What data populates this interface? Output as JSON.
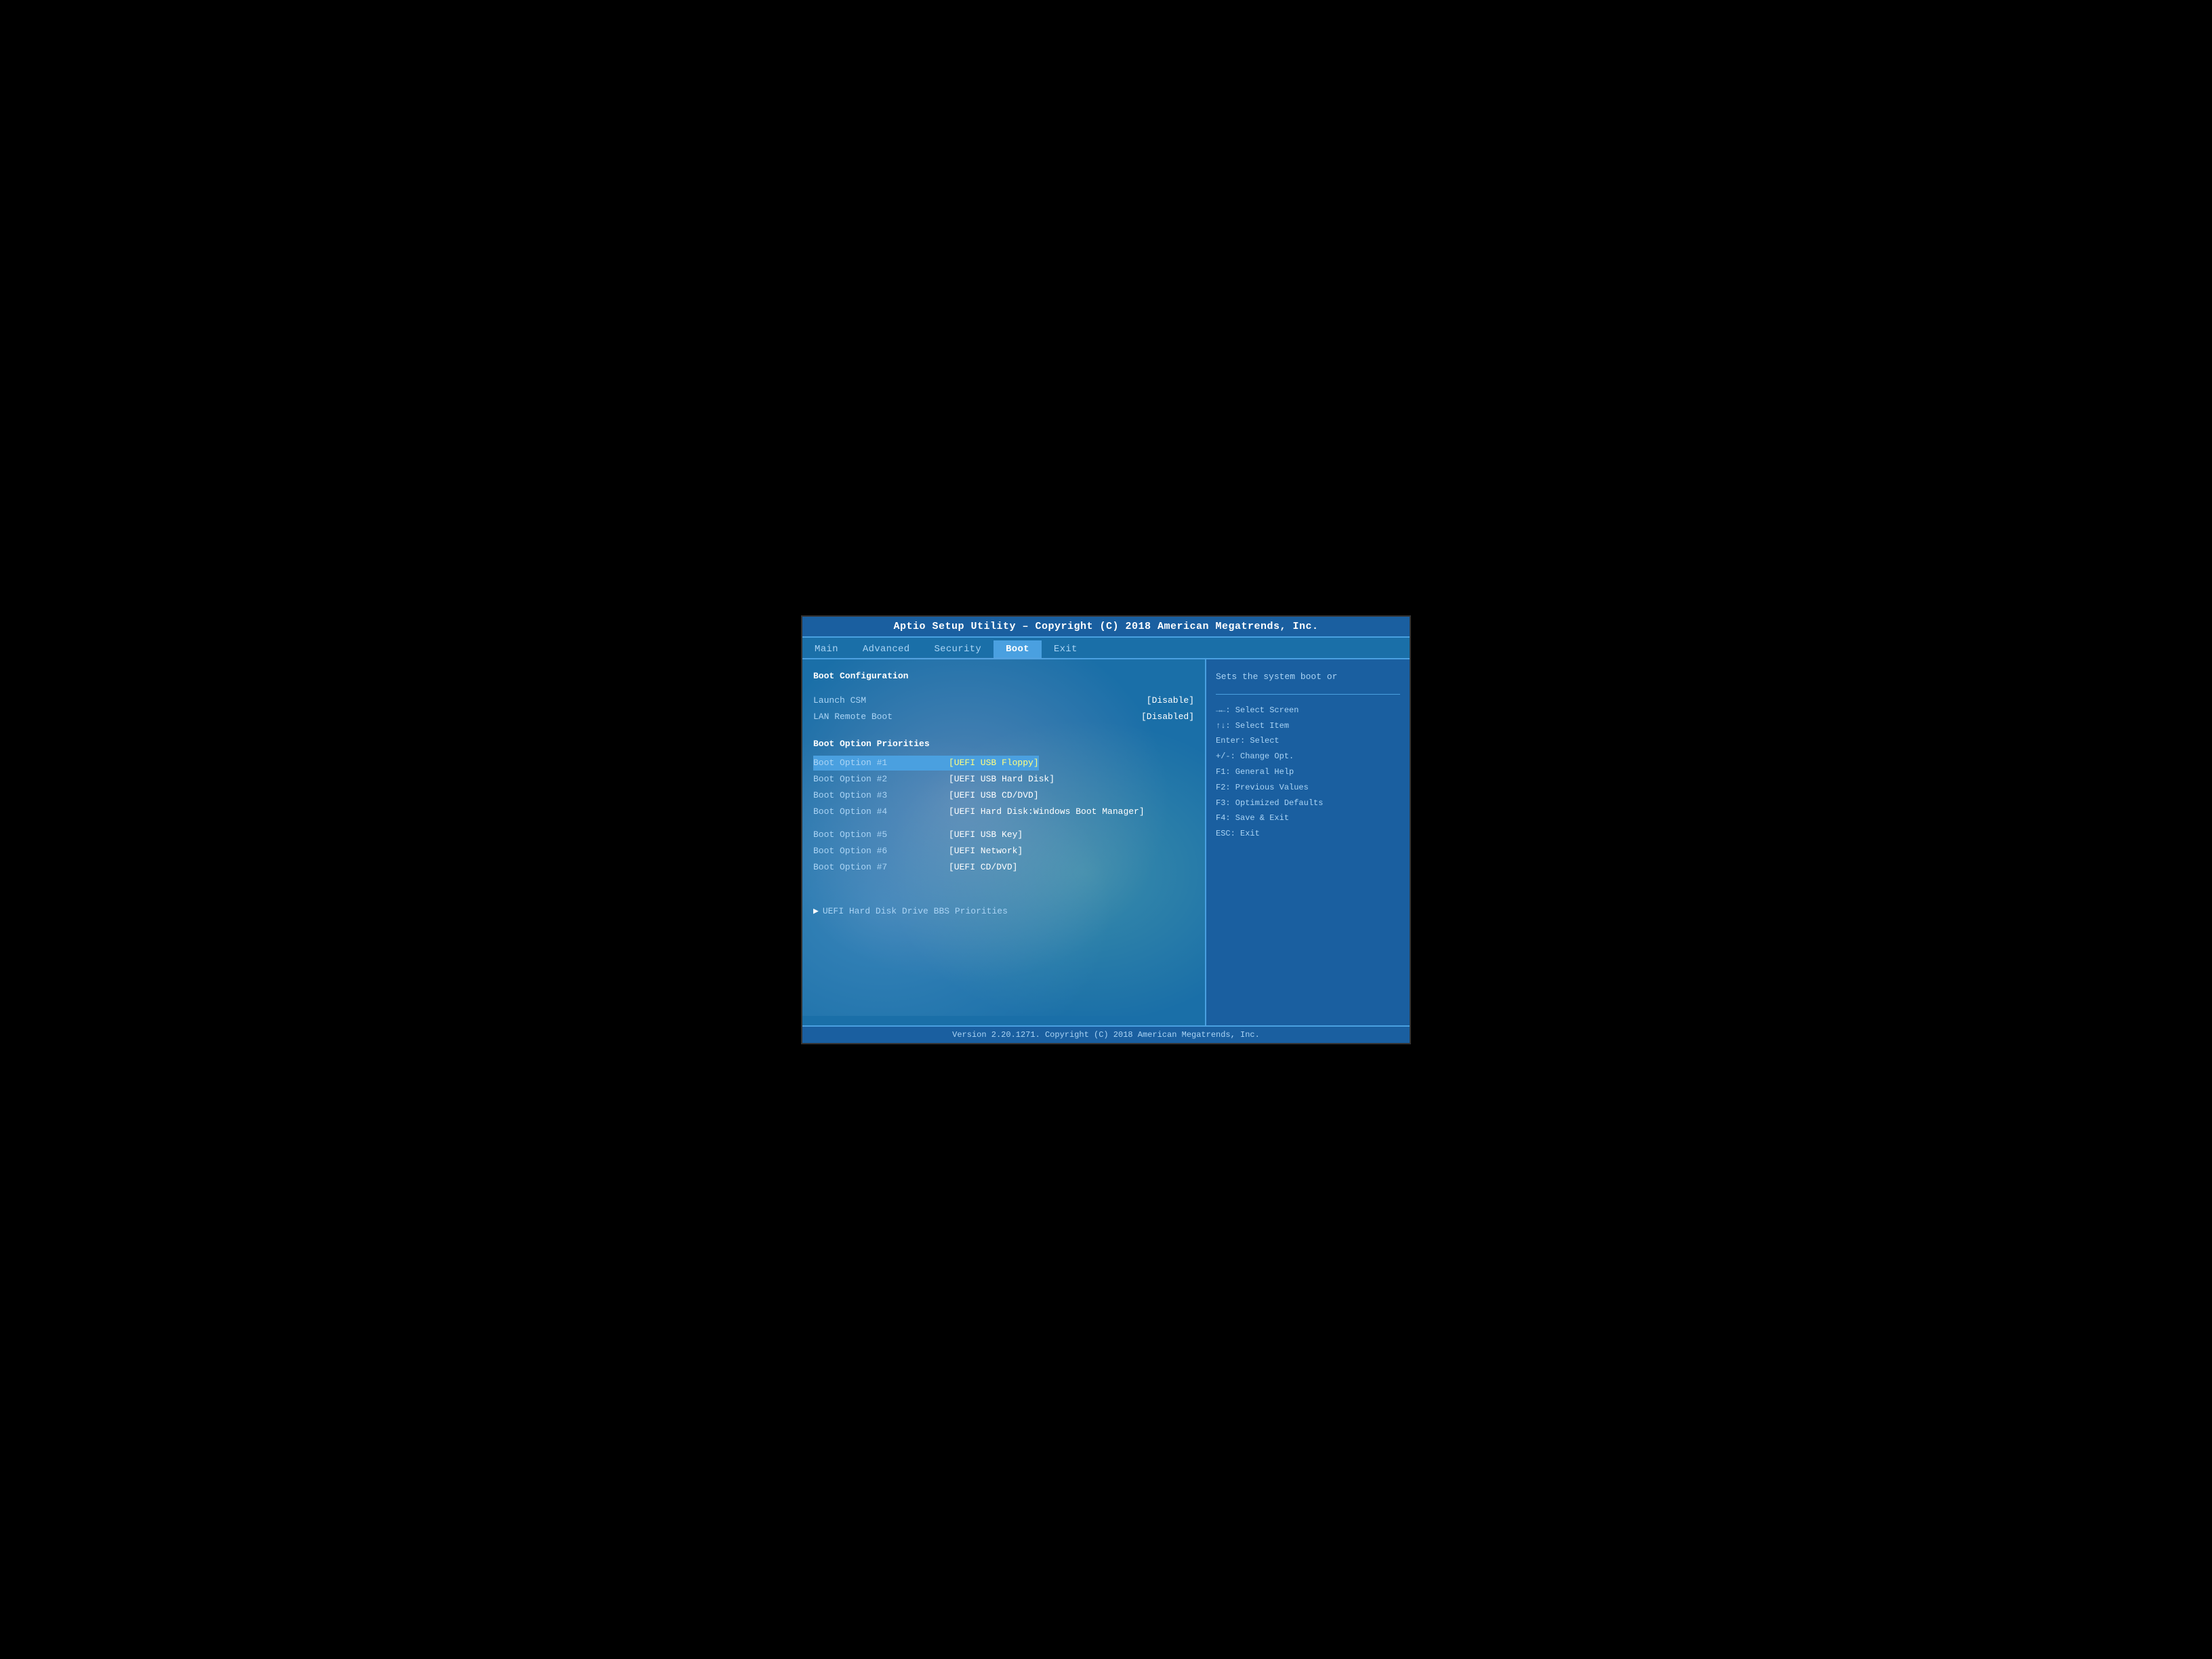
{
  "header": {
    "title": "Aptio Setup Utility – Copyright (C) 2018 American Megatrends, Inc."
  },
  "nav": {
    "items": [
      {
        "label": "Main",
        "active": false
      },
      {
        "label": "Advanced",
        "active": false
      },
      {
        "label": "Security",
        "active": false
      },
      {
        "label": "Boot",
        "active": true
      },
      {
        "label": "Exit",
        "active": false
      }
    ]
  },
  "left": {
    "section_title": "Boot Configuration",
    "launch_csm_label": "Launch CSM",
    "launch_csm_value": "[Disable]",
    "lan_remote_boot_label": "LAN Remote Boot",
    "lan_remote_boot_value": "[Disabled]",
    "boot_priorities_title": "Boot Option Priorities",
    "boot_options": [
      {
        "label": "Boot Option #1",
        "value": "[UEFI USB Floppy]",
        "highlighted": true
      },
      {
        "label": "Boot Option #2",
        "value": "[UEFI USB Hard Disk]"
      },
      {
        "label": "Boot Option #3",
        "value": "[UEFI USB CD/DVD]"
      },
      {
        "label": "Boot Option #4",
        "value": "[UEFI Hard Disk:Windows Boot Manager]"
      }
    ],
    "boot_options2": [
      {
        "label": "Boot Option #5",
        "value": "[UEFI USB Key]"
      },
      {
        "label": "Boot Option #6",
        "value": "[UEFI Network]"
      },
      {
        "label": "Boot Option #7",
        "value": "[UEFI CD/DVD]"
      }
    ],
    "bbs_label": "UEFI Hard Disk Drive BBS Priorities"
  },
  "right": {
    "help_top": "Sets the system boot or",
    "keys": [
      {
        "key": "→←:",
        "action": "Select Screen"
      },
      {
        "key": "↑↓:",
        "action": "Select Item"
      },
      {
        "key": "Enter:",
        "action": "Select"
      },
      {
        "key": "+/-:",
        "action": "Change Opt."
      },
      {
        "key": "F1:",
        "action": "General Help"
      },
      {
        "key": "F2:",
        "action": "Previous Values"
      },
      {
        "key": "F3:",
        "action": "Optimized Defaults"
      },
      {
        "key": "F4:",
        "action": "Save & Exit"
      },
      {
        "key": "ESC:",
        "action": "Exit"
      }
    ]
  },
  "footer": {
    "text": "Version 2.20.1271. Copyright (C) 2018 American Megatrends, Inc."
  }
}
